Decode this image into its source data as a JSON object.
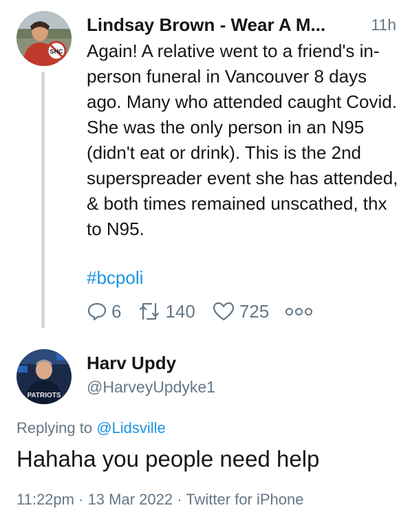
{
  "tweet": {
    "author_name": "Lindsay Brown - Wear A M...",
    "time": "11h",
    "body": "Again! A relative went to a friend's in-person funeral in Vancouver 8 days ago. Many who attended caught Covid. She was the only person in an N95 (didn't eat or drink). This is the 2nd superspreader event she has attended, & both times remained unscathed, thx to N95.",
    "hashtag": "#bcpoli",
    "replies": "6",
    "retweets": "140",
    "likes": "725",
    "avatar_badge": "SHC"
  },
  "reply": {
    "author_name": "Harv Updy",
    "handle": "@HarveyUpdyke1",
    "replying_prefix": "Replying to",
    "replying_to": "@Lidsville",
    "body": "Hahaha you people need help",
    "time": "11:22pm",
    "date": "13 Mar 2022",
    "source": "Twitter for iPhone",
    "separator": "·",
    "avatar_text": "PATRIOTS"
  },
  "colors": {
    "text": "#14171a",
    "secondary": "#657786",
    "link": "#1b95e0",
    "thread_line": "#cfd9de"
  }
}
